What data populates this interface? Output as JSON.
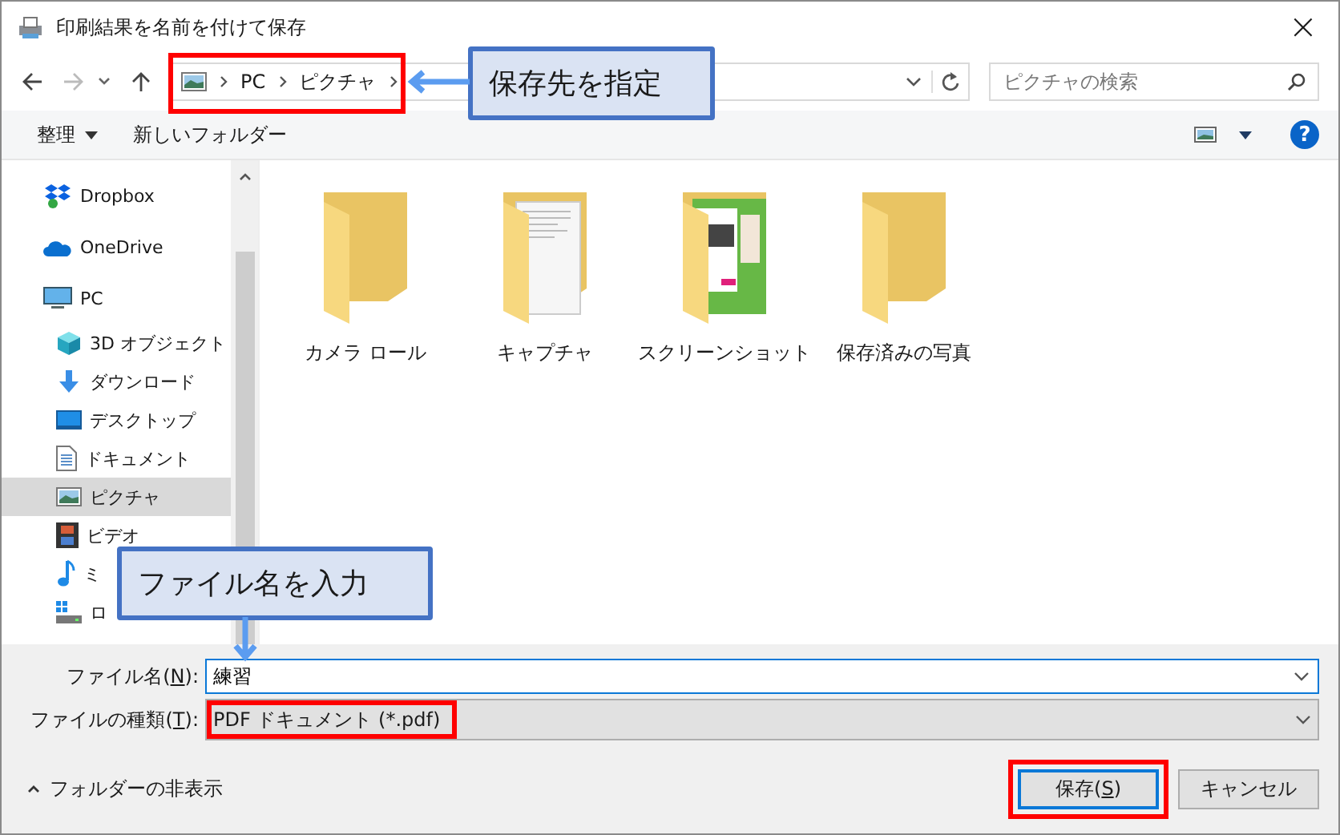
{
  "window": {
    "title": "印刷結果を名前を付けて保存",
    "close": "×"
  },
  "address_bar": {
    "path": [
      "PC",
      "ピクチャ"
    ],
    "highlighted": true
  },
  "search": {
    "placeholder": "ピクチャの検索"
  },
  "toolbar": {
    "organize": "整理",
    "new_folder": "新しいフォルダー",
    "help": "?"
  },
  "sidebar": {
    "items": [
      {
        "label": "Dropbox",
        "kind": "dropbox",
        "selected": false
      },
      {
        "label": "OneDrive",
        "kind": "cloud",
        "selected": false
      },
      {
        "label": "PC",
        "kind": "pc",
        "selected": false,
        "children": [
          {
            "label": "3D オブジェクト",
            "kind": "cube",
            "selected": false
          },
          {
            "label": "ダウンロード",
            "kind": "download",
            "selected": false
          },
          {
            "label": "デスクトップ",
            "kind": "desktop",
            "selected": false
          },
          {
            "label": "ドキュメント",
            "kind": "document",
            "selected": false
          },
          {
            "label": "ピクチャ",
            "kind": "pictures",
            "selected": true
          },
          {
            "label": "ビデオ",
            "kind": "video",
            "selected": false
          },
          {
            "label": "ミ",
            "kind": "music",
            "selected": false
          },
          {
            "label": "ロ",
            "kind": "drive",
            "selected": false
          }
        ]
      }
    ]
  },
  "folders": [
    {
      "name": "カメラ ロール",
      "kind": "empty"
    },
    {
      "name": "キャプチャ",
      "kind": "pages"
    },
    {
      "name": "スクリーンショット",
      "kind": "green-pages"
    },
    {
      "name": "保存済みの写真",
      "kind": "empty"
    }
  ],
  "form": {
    "file_name": {
      "label_start": "ファイル名(",
      "access_key": "N",
      "label_end": "):",
      "value": "練習"
    },
    "file_type": {
      "label_start": "ファイルの種類(",
      "access_key": "T",
      "label_end": "):",
      "value": "PDF ドキュメント (*.pdf)",
      "highlighted": true
    }
  },
  "hide_folders": "フォルダーの非表示",
  "buttons": [
    {
      "label_start": "保存(",
      "access_key": "S",
      "label_end": ")",
      "default": true,
      "highlighted": true
    },
    {
      "label_start": "キャンセル",
      "default": false,
      "highlighted": false
    }
  ],
  "callouts": [
    {
      "text": "保存先を指定",
      "kind": "left-arrow"
    },
    {
      "text": "ファイル名を入力",
      "kind": "down-arrow"
    }
  ]
}
